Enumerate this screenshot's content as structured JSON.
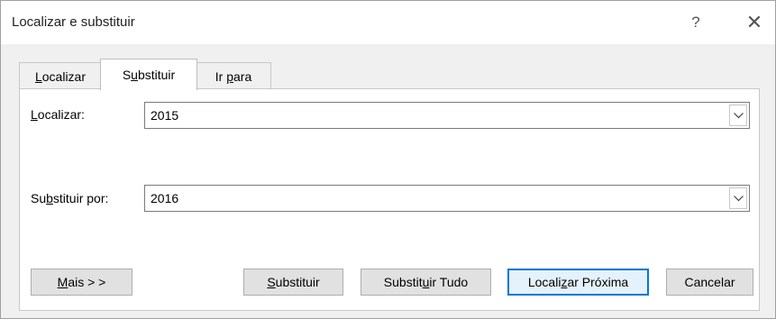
{
  "window": {
    "title": "Localizar e substituir",
    "help_glyph": "?",
    "close_glyph": "✕"
  },
  "tabs": [
    {
      "pre": "",
      "key": "L",
      "post": "ocalizar",
      "active": false
    },
    {
      "pre": "S",
      "key": "u",
      "post": "bstituir",
      "active": true
    },
    {
      "pre": "Ir ",
      "key": "p",
      "post": "ara",
      "active": false
    }
  ],
  "find": {
    "label_pre": "",
    "label_key": "L",
    "label_post": "ocalizar:",
    "value": "2015"
  },
  "replace": {
    "label_pre": "Su",
    "label_key": "b",
    "label_post": "stituir por:",
    "value": "2016"
  },
  "buttons": {
    "more": {
      "pre": "",
      "key": "M",
      "post": "ais > >"
    },
    "replace": {
      "pre": "",
      "key": "S",
      "post": "ubstituir"
    },
    "replace_all": {
      "pre": "Substit",
      "key": "u",
      "post": "ir Tudo"
    },
    "find_next": {
      "pre": "Locali",
      "key": "z",
      "post": "ar Próxima"
    },
    "cancel": "Cancelar"
  },
  "colors": {
    "accent": "#0078d7"
  }
}
